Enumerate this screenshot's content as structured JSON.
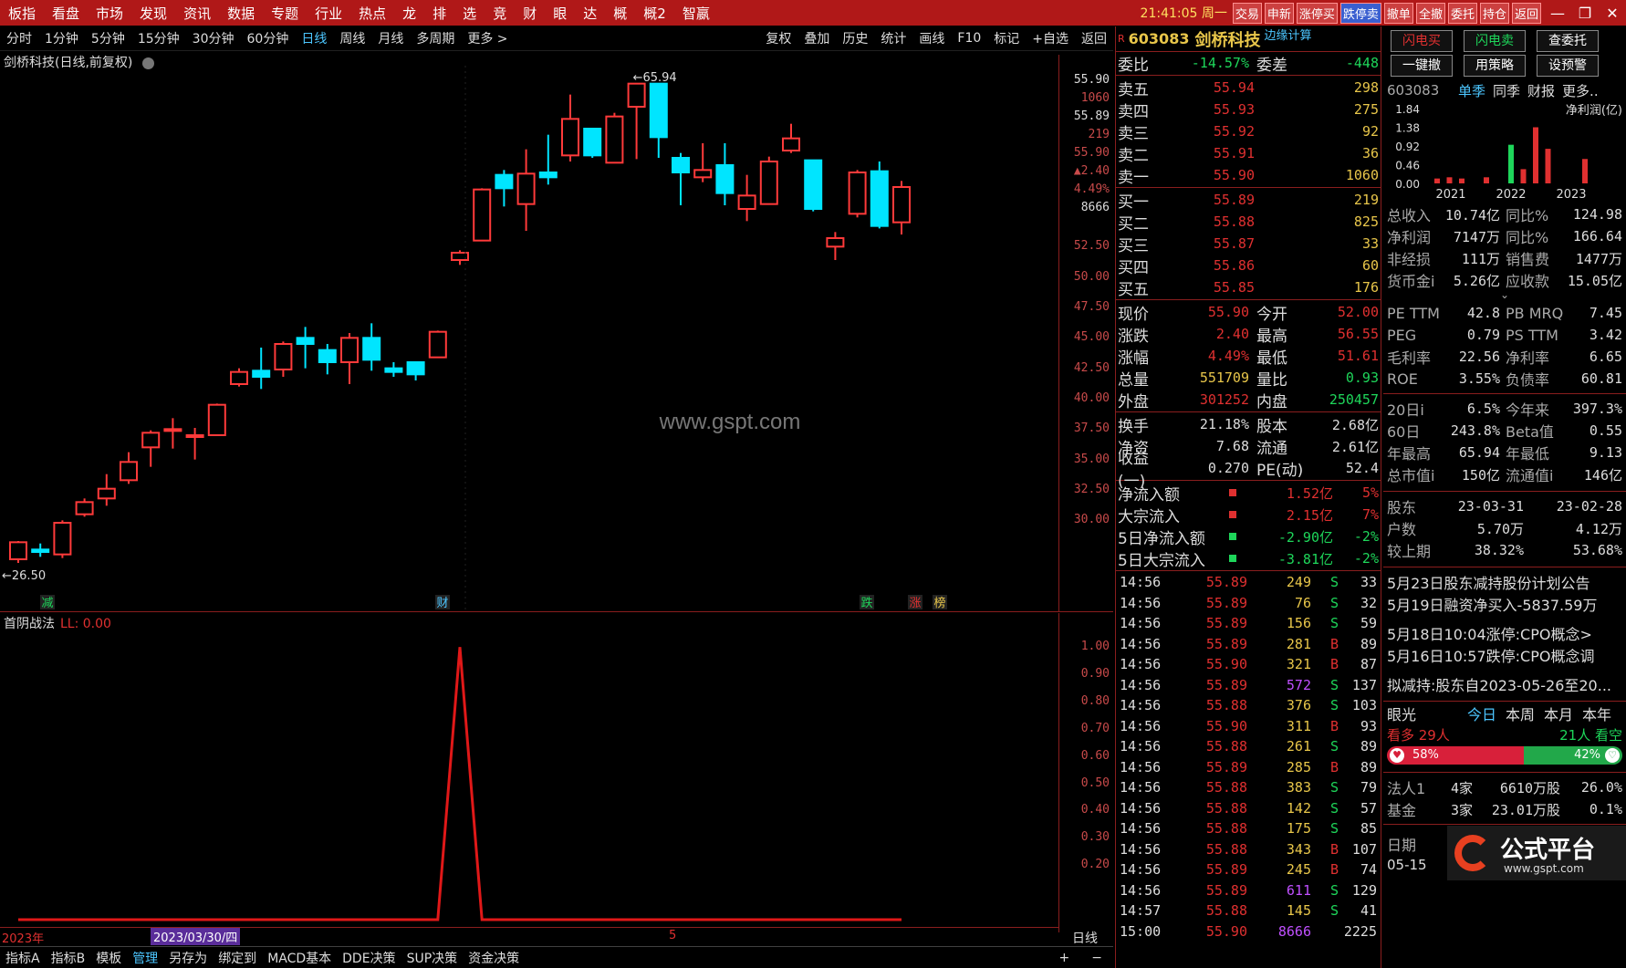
{
  "menubar": {
    "items": [
      "板指",
      "看盘",
      "市场",
      "发现",
      "资讯",
      "数据",
      "专题",
      "行业",
      "热点",
      "龙",
      "排",
      "选",
      "竞",
      "财",
      "眼",
      "达",
      "概",
      "概2",
      "智嬴"
    ],
    "clock": "21:41:05 周一",
    "right_buttons": [
      "交易",
      "申新",
      "涨停买",
      "跌停卖",
      "撤单",
      "全撤",
      "委托",
      "持仓",
      "返回"
    ],
    "window_controls": [
      "—",
      "❐",
      "✕"
    ]
  },
  "toolbar": {
    "periods": [
      "分时",
      "1分钟",
      "5分钟",
      "15分钟",
      "30分钟",
      "60分钟",
      "日线",
      "周线",
      "月线",
      "多周期",
      "更多 >"
    ],
    "active_period": "日线",
    "tools": [
      "复权",
      "叠加",
      "历史",
      "统计",
      "画线",
      "F10",
      "标记",
      "+自选",
      "返回"
    ]
  },
  "chart": {
    "title": "剑桥科技(日线,前复权)",
    "watermark": "www.gspt.com",
    "high_label": "65.94",
    "low_label": "26.50",
    "markers": [
      {
        "text": "减",
        "color": "#1ed65a"
      },
      {
        "text": "财",
        "color": "#4cc6ff"
      },
      {
        "text": "跌",
        "color": "#1ed65a"
      },
      {
        "text": "涨",
        "color": "#e03030"
      },
      {
        "text": "榜",
        "color": "#e8c64a"
      }
    ]
  },
  "chart_data": {
    "type": "candlestick",
    "title": "剑桥科技(日线,前复权)",
    "ylim": [
      28,
      67
    ],
    "y_ticks": [
      "50.00",
      "47.50",
      "45.00",
      "42.50",
      "40.00",
      "37.50",
      "35.00",
      "32.50",
      "30.00"
    ],
    "candles": [
      [
        26.8,
        28.2,
        26.5,
        28.3
      ],
      [
        27.6,
        27.4,
        27.0,
        28.1
      ],
      [
        27.2,
        29.8,
        26.9,
        30.0
      ],
      [
        30.5,
        31.5,
        30.3,
        31.8
      ],
      [
        31.8,
        32.6,
        31.2,
        33.8
      ],
      [
        33.3,
        34.8,
        33.0,
        35.6
      ],
      [
        36.0,
        37.2,
        34.4,
        37.4
      ],
      [
        37.5,
        37.5,
        35.9,
        38.4
      ],
      [
        37.0,
        37.0,
        35.0,
        37.6
      ],
      [
        37.0,
        39.5,
        37.0,
        39.6
      ],
      [
        41.2,
        42.2,
        41.0,
        42.5
      ],
      [
        42.3,
        41.8,
        40.8,
        44.2
      ],
      [
        42.4,
        44.5,
        41.8,
        44.7
      ],
      [
        45.0,
        44.5,
        42.5,
        45.9
      ],
      [
        44.0,
        43.0,
        42.0,
        44.5
      ],
      [
        43.0,
        45.0,
        41.2,
        45.4
      ],
      [
        45.0,
        43.2,
        42.3,
        46.2
      ],
      [
        42.5,
        42.2,
        41.8,
        43.0
      ],
      [
        43.0,
        42.0,
        41.5,
        43.0
      ],
      [
        43.4,
        45.5,
        43.4,
        45.6
      ],
      [
        51.4,
        52.0,
        51.0,
        52.2
      ],
      [
        53.0,
        57.2,
        53.0,
        57.3
      ],
      [
        58.4,
        57.3,
        55.8,
        58.8
      ],
      [
        56.0,
        58.5,
        53.8,
        60.5
      ],
      [
        58.6,
        58.2,
        57.6,
        61.7
      ],
      [
        60.0,
        63.0,
        59.5,
        65.0
      ],
      [
        62.2,
        60.0,
        59.8,
        61.9
      ],
      [
        59.4,
        63.2,
        59.4,
        63.5
      ],
      [
        64.0,
        65.9,
        59.7,
        65.9
      ],
      [
        65.9,
        61.5,
        59.8,
        65.9
      ],
      [
        59.8,
        58.6,
        55.9,
        60.2
      ],
      [
        58.2,
        58.8,
        57.8,
        61.0
      ],
      [
        59.2,
        56.9,
        55.9,
        61.0
      ],
      [
        55.6,
        56.7,
        54.6,
        58.4
      ],
      [
        56.0,
        59.5,
        56.0,
        59.9
      ],
      [
        60.4,
        61.4,
        60.2,
        62.6
      ],
      [
        59.6,
        55.6,
        55.4,
        59.6
      ],
      [
        52.5,
        53.2,
        51.4,
        53.7
      ],
      [
        55.2,
        58.6,
        54.9,
        58.8
      ],
      [
        58.7,
        54.2,
        54.0,
        59.5
      ],
      [
        54.5,
        57.4,
        53.5,
        57.9
      ]
    ],
    "indicator": {
      "name": "首阴战法",
      "value_label": "LL: 0.00",
      "ylim": [
        0,
        1
      ],
      "y_ticks": [
        "1.00",
        "0.90",
        "0.80",
        "0.70",
        "0.60",
        "0.50",
        "0.40",
        "0.30",
        "0.20"
      ],
      "values": [
        0,
        0,
        0,
        0,
        0,
        0,
        0,
        0,
        0,
        0,
        0,
        0,
        0,
        0,
        0,
        0,
        0,
        0,
        0,
        0,
        1,
        0,
        0,
        0,
        0,
        0,
        0,
        0,
        0,
        0,
        0,
        0,
        0,
        0,
        0,
        0,
        0,
        0,
        0,
        0,
        0
      ]
    }
  },
  "price_axis": {
    "top": [
      "55.90",
      "1060",
      "55.89",
      "219",
      "55.90",
      "▲2.40",
      "4.49%",
      "8666"
    ],
    "ticks": [
      "52.50",
      "50.00",
      "47.50",
      "45.00",
      "42.50",
      "40.00",
      "37.50",
      "35.00",
      "32.50",
      "30.00"
    ]
  },
  "date_bar": {
    "left": "2023年",
    "date": "2023/03/30/四",
    "mid": "5",
    "right": "日线"
  },
  "bottom_tabs": [
    "指标A",
    "指标B",
    "模板",
    "管理",
    "另存为",
    "绑定到",
    "MACD基本",
    "DDE决策",
    "SUP决策",
    "资金决策"
  ],
  "bottom_active": "管理",
  "bottom_right": [
    "+",
    "−"
  ],
  "quote": {
    "header_code": "603083",
    "header_name": "剑桥科技",
    "header_tag": "边缘计算",
    "weibi": {
      "label": "委比",
      "value": "-14.57%",
      "label2": "委差",
      "value2": "-448"
    },
    "sells": [
      {
        "l": "卖五",
        "p": "55.94",
        "n": "298"
      },
      {
        "l": "卖四",
        "p": "55.93",
        "n": "275"
      },
      {
        "l": "卖三",
        "p": "55.92",
        "n": "92"
      },
      {
        "l": "卖二",
        "p": "55.91",
        "n": "36"
      },
      {
        "l": "卖一",
        "p": "55.90",
        "n": "1060"
      }
    ],
    "buys": [
      {
        "l": "买一",
        "p": "55.89",
        "n": "219"
      },
      {
        "l": "买二",
        "p": "55.88",
        "n": "825"
      },
      {
        "l": "买三",
        "p": "55.87",
        "n": "33"
      },
      {
        "l": "买四",
        "p": "55.86",
        "n": "60"
      },
      {
        "l": "买五",
        "p": "55.85",
        "n": "176"
      }
    ],
    "stats1": [
      {
        "k": "现价",
        "v": "55.90",
        "vc": "red",
        "k2": "今开",
        "v2": "52.00",
        "v2c": "red"
      },
      {
        "k": "涨跌",
        "v": "2.40",
        "vc": "red",
        "k2": "最高",
        "v2": "56.55",
        "v2c": "red"
      },
      {
        "k": "涨幅",
        "v": "4.49%",
        "vc": "red",
        "k2": "最低",
        "v2": "51.61",
        "v2c": "red"
      },
      {
        "k": "总量",
        "v": "551709",
        "vc": "yel",
        "k2": "量比",
        "v2": "0.93",
        "v2c": "grn"
      },
      {
        "k": "外盘",
        "v": "301252",
        "vc": "red",
        "k2": "内盘",
        "v2": "250457",
        "v2c": "grn"
      }
    ],
    "stats2": [
      {
        "k": "换手",
        "v": "21.18%",
        "vc": "wht",
        "k2": "股本",
        "v2": "2.68亿",
        "v2c": "wht"
      },
      {
        "k": "净资",
        "v": "7.68",
        "vc": "wht",
        "k2": "流通",
        "v2": "2.61亿",
        "v2c": "wht"
      },
      {
        "k": "收益(一)",
        "v": "0.270",
        "vc": "wht",
        "k2": "PE(动)",
        "v2": "52.4",
        "v2c": "wht"
      }
    ],
    "flows": [
      {
        "k": "净流入额",
        "v": "1.52亿",
        "pc": "5%",
        "c": "red",
        "sq": "#e03030"
      },
      {
        "k": "大宗流入",
        "v": "2.15亿",
        "pc": "7%",
        "c": "red",
        "sq": "#e03030"
      },
      {
        "k": "5日净流入额",
        "v": "-2.90亿",
        "pc": "-2%",
        "c": "grn",
        "sq": "#1ed65a"
      },
      {
        "k": "5日大宗流入",
        "v": "-3.81亿",
        "pc": "-2%",
        "c": "grn",
        "sq": "#1ed65a"
      }
    ],
    "ticks": [
      {
        "t": "14:56",
        "p": "55.89",
        "v": "249",
        "bs": "S",
        "c": "33"
      },
      {
        "t": "14:56",
        "p": "55.89",
        "v": "76",
        "bs": "S",
        "c": "32"
      },
      {
        "t": "14:56",
        "p": "55.89",
        "v": "156",
        "bs": "S",
        "c": "59"
      },
      {
        "t": "14:56",
        "p": "55.89",
        "v": "281",
        "bs": "B",
        "c": "89"
      },
      {
        "t": "14:56",
        "p": "55.90",
        "v": "321",
        "bs": "B",
        "c": "87"
      },
      {
        "t": "14:56",
        "p": "55.89",
        "v": "572",
        "bs": "S",
        "c": "137"
      },
      {
        "t": "14:56",
        "p": "55.88",
        "v": "376",
        "bs": "S",
        "c": "103"
      },
      {
        "t": "14:56",
        "p": "55.90",
        "v": "311",
        "bs": "B",
        "c": "93"
      },
      {
        "t": "14:56",
        "p": "55.88",
        "v": "261",
        "bs": "S",
        "c": "89"
      },
      {
        "t": "14:56",
        "p": "55.89",
        "v": "285",
        "bs": "B",
        "c": "89"
      },
      {
        "t": "14:56",
        "p": "55.88",
        "v": "383",
        "bs": "S",
        "c": "79"
      },
      {
        "t": "14:56",
        "p": "55.88",
        "v": "142",
        "bs": "S",
        "c": "57"
      },
      {
        "t": "14:56",
        "p": "55.88",
        "v": "175",
        "bs": "S",
        "c": "85"
      },
      {
        "t": "14:56",
        "p": "55.88",
        "v": "343",
        "bs": "B",
        "c": "107"
      },
      {
        "t": "14:56",
        "p": "55.89",
        "v": "245",
        "bs": "B",
        "c": "74"
      },
      {
        "t": "14:56",
        "p": "55.89",
        "v": "611",
        "bs": "S",
        "c": "129"
      },
      {
        "t": "14:57",
        "p": "55.88",
        "v": "145",
        "bs": "S",
        "c": "41"
      },
      {
        "t": "15:00",
        "p": "55.90",
        "v": "8666",
        "bs": "",
        "c": "2225"
      }
    ]
  },
  "rpanel": {
    "buttons": [
      "闪电买",
      "闪电卖",
      "查委托",
      "一键撤",
      "用策略",
      "设预警"
    ],
    "code": "603083",
    "tabs": [
      "单季",
      "同季",
      "财报",
      "更多.."
    ],
    "mini_title": "净利润(亿)",
    "mini_ticks": [
      "1.84",
      "1.38",
      "0.92",
      "0.46",
      "0.00"
    ],
    "mini_years": [
      "2021",
      "2022",
      "2023"
    ],
    "mini_values": [
      0.12,
      0.15,
      0.12,
      0,
      0.15,
      0,
      0.95,
      0.35,
      1.38,
      0.85,
      0,
      0,
      0.6
    ],
    "fin1": [
      {
        "k": "总收入",
        "v": "10.74亿",
        "k2": "同比%",
        "v2": "124.98"
      },
      {
        "k": "净利润",
        "v": "7147万",
        "k2": "同比%",
        "v2": "166.64"
      },
      {
        "k": "非经损",
        "v": "111万",
        "k2": "销售费",
        "v2": "1477万"
      },
      {
        "k": "货币金i",
        "v": "5.26亿",
        "k2": "应收款",
        "v2": "15.05亿"
      }
    ],
    "fin2": [
      {
        "k": "PE TTM",
        "v": "42.8",
        "k2": "PB MRQ",
        "v2": "7.45"
      },
      {
        "k": "PEG",
        "v": "0.79",
        "k2": "PS TTM",
        "v2": "3.42"
      },
      {
        "k": "毛利率",
        "v": "22.56",
        "k2": "净利率",
        "v2": "6.65"
      },
      {
        "k": "ROE",
        "v": "3.55%",
        "k2": "负债率",
        "v2": "60.81"
      }
    ],
    "fin3": [
      {
        "k": "20日i",
        "v": "6.5%",
        "k2": "今年来",
        "v2": "397.3%"
      },
      {
        "k": "60日",
        "v": "243.8%",
        "k2": "Beta值",
        "v2": "0.55"
      },
      {
        "k": "年最高",
        "v": "65.94",
        "k2": "年最低",
        "v2": "9.13"
      },
      {
        "k": "总市值i",
        "v": "150亿",
        "k2": "流通值i",
        "v2": "146亿"
      }
    ],
    "holders": [
      {
        "k": "股东",
        "v": "23-03-31",
        "v2": "23-02-28"
      },
      {
        "k": "户数",
        "v": "5.70万",
        "v2": "4.12万"
      },
      {
        "k": "较上期",
        "v": "38.32%",
        "v2": "53.68%"
      }
    ],
    "news": [
      {
        "text": "5月23日股东减持股份计划公告",
        "c": "wht"
      },
      {
        "text": "5月19日融资净买入-5837.59万",
        "c": "red"
      },
      {
        "text": "5月18日10:04涨停:CPO概念>",
        "c": "wht"
      },
      {
        "text": "5月16日10:57跌停:CPO概念调",
        "c": "wht"
      },
      {
        "text": "拟减持:股东自2023-05-26至20...",
        "c": "wht"
      }
    ],
    "vision": {
      "title": "眼光",
      "tabs": [
        "今日",
        "本周",
        "本月",
        "本年"
      ],
      "bull": "看多 29人",
      "bear": "21人 看空",
      "bull_pct": "58%",
      "bear_pct": "42%",
      "bull_frac": 0.58
    },
    "inst": [
      {
        "k": "法人1",
        "v": "4家",
        "v2": "6610万股",
        "v3": "26.0%"
      },
      {
        "k": "基金",
        "v": "3家",
        "v2": "23.01万股",
        "v3": "0.1%"
      }
    ],
    "date_label": "日期",
    "date_value": "05-15",
    "logo_text": "公式平台",
    "logo_url": "www.gspt.com"
  }
}
